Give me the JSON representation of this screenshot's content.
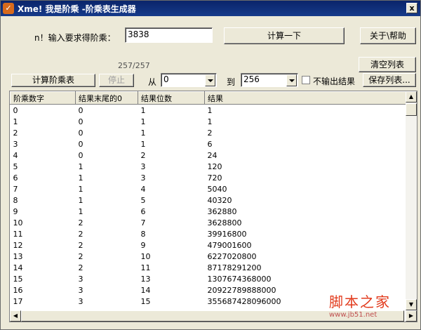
{
  "window": {
    "title": "Xme! 我是阶乘  -阶乘表生成器",
    "app_icon_glyph": "✓",
    "close_glyph": "x"
  },
  "form": {
    "n_label": "n！输入要求得阶乘：",
    "n_value": "3838",
    "calc_button": "计算一下",
    "about_button": "关于\\帮助",
    "progress_text": "257/257",
    "clear_button": "清空列表",
    "calc_table_button": "计算阶乘表",
    "stop_button": "停止",
    "from_label": "从",
    "from_value": "0",
    "to_label": "到",
    "to_value": "256",
    "no_output_label": "不输出结果",
    "save_button": "保存列表..."
  },
  "table": {
    "columns": [
      "阶乘数字",
      "结果末尾的0",
      "结果位数",
      "结果"
    ],
    "rows": [
      [
        "0",
        "0",
        "1",
        "1"
      ],
      [
        "1",
        "0",
        "1",
        "1"
      ],
      [
        "2",
        "0",
        "1",
        "2"
      ],
      [
        "3",
        "0",
        "1",
        "6"
      ],
      [
        "4",
        "0",
        "2",
        "24"
      ],
      [
        "5",
        "1",
        "3",
        "120"
      ],
      [
        "6",
        "1",
        "3",
        "720"
      ],
      [
        "7",
        "1",
        "4",
        "5040"
      ],
      [
        "8",
        "1",
        "5",
        "40320"
      ],
      [
        "9",
        "1",
        "6",
        "362880"
      ],
      [
        "10",
        "2",
        "7",
        "3628800"
      ],
      [
        "11",
        "2",
        "8",
        "39916800"
      ],
      [
        "12",
        "2",
        "9",
        "479001600"
      ],
      [
        "13",
        "2",
        "10",
        "6227020800"
      ],
      [
        "14",
        "2",
        "11",
        "87178291200"
      ],
      [
        "15",
        "3",
        "13",
        "1307674368000"
      ],
      [
        "16",
        "3",
        "14",
        "20922789888000"
      ],
      [
        "17",
        "3",
        "15",
        "355687428096000"
      ]
    ]
  },
  "watermark": {
    "main": "脚本之家",
    "url": "www.jb51.net"
  },
  "colors": {
    "titlebar": "#0a246a",
    "window_bg": "#ece9d8",
    "watermark": "#e23a1c"
  }
}
